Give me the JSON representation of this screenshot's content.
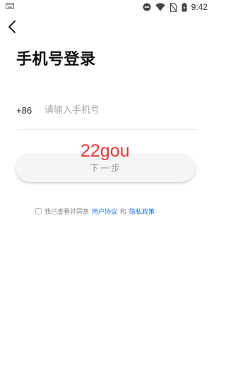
{
  "status_bar": {
    "time": "9:42",
    "icons": [
      "keyboard-icon",
      "do-not-disturb-icon",
      "wifi-icon",
      "no-sim-icon",
      "battery-icon"
    ]
  },
  "header": {
    "back_icon": "chevron-left-icon",
    "title": "手机号登录"
  },
  "form": {
    "country_code": "+86",
    "phone_placeholder": "请输入手机号",
    "phone_value": "",
    "next_label": "下一步"
  },
  "watermark": "22gou",
  "agreement": {
    "checked": false,
    "prefix": "我已查看并同意",
    "user_agreement": "用户协议",
    "conjunction": "和",
    "privacy_policy": "隐私政策",
    "link_color": "#1e73e8"
  }
}
